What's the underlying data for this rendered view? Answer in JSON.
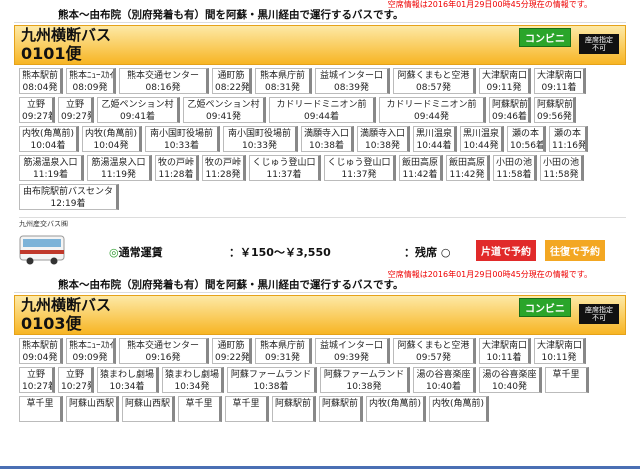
{
  "vacancy_info": "空席情報は2016年01月29日00時45分現在の情報です。",
  "buses": [
    {
      "route_desc": "熊本～由布院（別府発着も有）間を阿蘇・黒川経由で運行するバスです。",
      "title": "九州横断バス",
      "number": "0101便",
      "convenience_label": "コンビニ",
      "seat_label_1": "座席指定",
      "seat_label_2": "不可",
      "stops": [
        {
          "name": "熊本駅前",
          "time": "08:04発",
          "w": 44
        },
        {
          "name": "熊本ﾆｭｰｽｶｲ",
          "time": "08:09発",
          "w": 50
        },
        {
          "name": "熊本交通センター",
          "time": "08:16発",
          "w": 90
        },
        {
          "name": "通町筋",
          "time": "08:22発",
          "w": 40
        },
        {
          "name": "熊本県庁前",
          "time": "08:31発",
          "w": 57
        },
        {
          "name": "益城インター口",
          "time": "08:39発",
          "w": 75
        },
        {
          "name": "阿蘇くまもと空港",
          "time": "08:57発",
          "w": 83
        },
        {
          "name": "大津駅南口",
          "time": "09:11発",
          "w": 52
        },
        {
          "name": "大津駅南口",
          "time": "09:11着",
          "w": 52
        },
        {
          "name": "立野",
          "time": "09:27着",
          "w": 36
        },
        {
          "name": "立野",
          "time": "09:27発",
          "w": 36
        },
        {
          "name": "乙姫ペンション村",
          "time": "09:41着",
          "w": 83
        },
        {
          "name": "乙姫ペンション村",
          "time": "09:41発",
          "w": 83
        },
        {
          "name": "カドリードミニオン前",
          "time": "09:44着",
          "w": 107
        },
        {
          "name": "カドリードミニオン前",
          "time": "09:44発",
          "w": 107
        },
        {
          "name": "阿蘇駅前",
          "time": "09:46着",
          "w": 42
        },
        {
          "name": "阿蘇駅前",
          "time": "09:56発",
          "w": 42
        },
        {
          "name": "内牧(角萬前)",
          "time": "10:04着",
          "w": 60
        },
        {
          "name": "内牧(角萬前)",
          "time": "10:04発",
          "w": 60
        },
        {
          "name": "南小国町役場前",
          "time": "10:33着",
          "w": 75
        },
        {
          "name": "南小国町役場前",
          "time": "10:33発",
          "w": 75
        },
        {
          "name": "満願寺入口",
          "time": "10:38着",
          "w": 53
        },
        {
          "name": "満願寺入口",
          "time": "10:38発",
          "w": 53
        },
        {
          "name": "黒川温泉",
          "time": "10:44着",
          "w": 44
        },
        {
          "name": "黒川温泉",
          "time": "10:44発",
          "w": 44
        },
        {
          "name": "瀬の本",
          "time": "10:56着",
          "w": 39
        },
        {
          "name": "瀬の本",
          "time": "11:16発",
          "w": 39
        },
        {
          "name": "筋湯温泉入口",
          "time": "11:19着",
          "w": 65
        },
        {
          "name": "筋湯温泉入口",
          "time": "11:19発",
          "w": 65
        },
        {
          "name": "牧の戸峠",
          "time": "11:28着",
          "w": 44
        },
        {
          "name": "牧の戸峠",
          "time": "11:28発",
          "w": 44
        },
        {
          "name": "くじゅう登山口",
          "time": "11:37着",
          "w": 72
        },
        {
          "name": "くじゅう登山口",
          "time": "11:37発",
          "w": 72
        },
        {
          "name": "飯田高原",
          "time": "11:42着",
          "w": 44
        },
        {
          "name": "飯田高原",
          "time": "11:42発",
          "w": 44
        },
        {
          "name": "小田の池",
          "time": "11:58着",
          "w": 44
        },
        {
          "name": "小田の池",
          "time": "11:58発",
          "w": 44
        },
        {
          "name": "由布院駅前バスセンタ",
          "time": "12:19着",
          "w": 100
        }
      ],
      "company": "九州産交バス㈱",
      "fare_type": "通常運賃",
      "fare_price": "：￥150～￥3,550",
      "seat_status": "：残席 ○",
      "btn_oneway": "片道で予約",
      "btn_roundtrip": "往復で予約"
    },
    {
      "route_desc": "熊本～由布院（別府発着も有）間を阿蘇・黒川経由で運行するバスです。",
      "title": "九州横断バス",
      "number": "0103便",
      "convenience_label": "コンビニ",
      "seat_label_1": "座席指定",
      "seat_label_2": "不可",
      "stops": [
        {
          "name": "熊本駅前",
          "time": "09:04発",
          "w": 44
        },
        {
          "name": "熊本ﾆｭｰｽｶｲ",
          "time": "09:09発",
          "w": 50
        },
        {
          "name": "熊本交通センター",
          "time": "09:16発",
          "w": 90
        },
        {
          "name": "通町筋",
          "time": "09:22発",
          "w": 40
        },
        {
          "name": "熊本県庁前",
          "time": "09:31発",
          "w": 57
        },
        {
          "name": "益城インター口",
          "time": "09:39発",
          "w": 75
        },
        {
          "name": "阿蘇くまもと空港",
          "time": "09:57発",
          "w": 83
        },
        {
          "name": "大津駅南口",
          "time": "10:11着",
          "w": 52
        },
        {
          "name": "大津駅南口",
          "time": "10:11発",
          "w": 52
        },
        {
          "name": "立野",
          "time": "10:27着",
          "w": 36
        },
        {
          "name": "立野",
          "time": "10:27発",
          "w": 36
        },
        {
          "name": "猿まわし劇場",
          "time": "10:34着",
          "w": 62
        },
        {
          "name": "猿まわし劇場",
          "time": "10:34発",
          "w": 62
        },
        {
          "name": "阿蘇ファームランド",
          "time": "10:38着",
          "w": 90
        },
        {
          "name": "阿蘇ファームランド",
          "time": "10:38発",
          "w": 90
        },
        {
          "name": "湯の谷喜楽座",
          "time": "10:40着",
          "w": 63
        },
        {
          "name": "湯の谷喜楽座",
          "time": "10:40発",
          "w": 63
        },
        {
          "name": "草千里",
          "time": "",
          "w": 44
        },
        {
          "name": "草千里",
          "time": "",
          "w": 44
        },
        {
          "name": "阿蘇山西駅",
          "time": "",
          "w": 53
        },
        {
          "name": "阿蘇山西駅",
          "time": "",
          "w": 53
        },
        {
          "name": "草千里",
          "time": "",
          "w": 44
        },
        {
          "name": "草千里",
          "time": "",
          "w": 44
        },
        {
          "name": "阿蘇駅前",
          "time": "",
          "w": 44
        },
        {
          "name": "阿蘇駅前",
          "time": "",
          "w": 44
        },
        {
          "name": "内牧(角萬前)",
          "time": "",
          "w": 60
        },
        {
          "name": "内牧(角萬前)",
          "time": "",
          "w": 60
        }
      ]
    }
  ],
  "colors": {
    "header_top": "#fde9a6",
    "header_bottom": "#f7b524",
    "convenience": "#2aa52a",
    "oneway": "#e12a2a",
    "roundtrip": "#f3a722",
    "vacancy": "#ee0000"
  }
}
